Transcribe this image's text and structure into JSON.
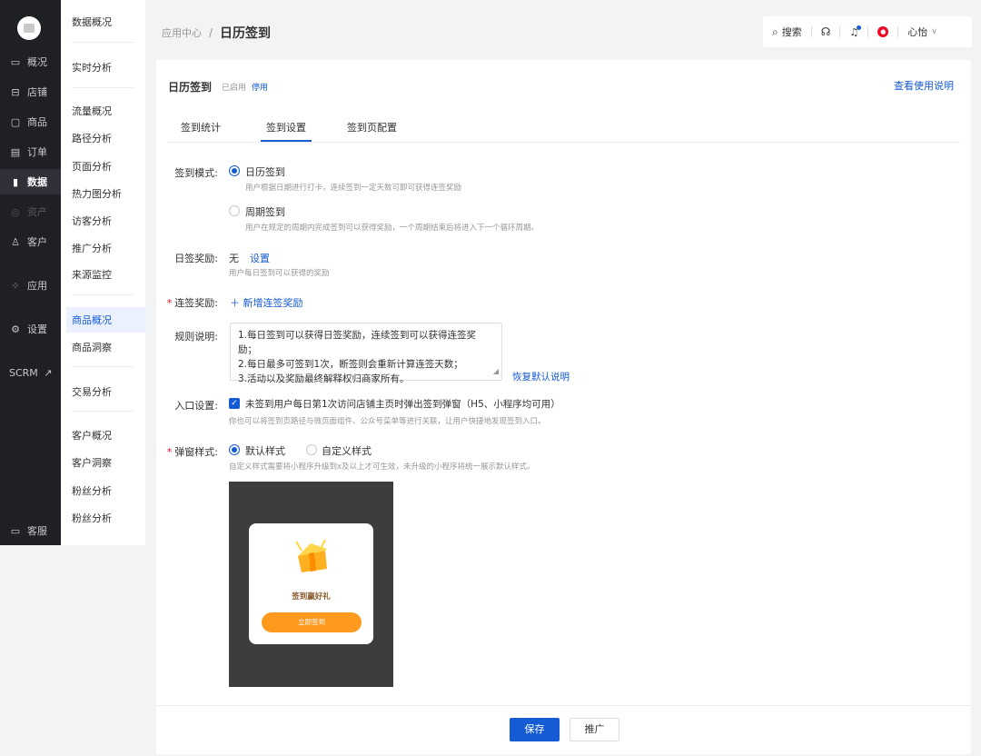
{
  "primary_nav": {
    "items": [
      {
        "icon": "chat-bubble-icon",
        "label": "概况"
      },
      {
        "icon": "store-icon",
        "label": "店铺"
      },
      {
        "icon": "bag-icon",
        "label": "商品"
      },
      {
        "icon": "document-icon",
        "label": "订单"
      },
      {
        "icon": "bar-chart-icon",
        "label": "数据"
      },
      {
        "icon": "coin-icon",
        "label": "资产"
      },
      {
        "icon": "user-icon",
        "label": "客户"
      },
      {
        "icon": "apps-icon",
        "label": "应用"
      },
      {
        "icon": "gear-icon",
        "label": "设置"
      },
      {
        "icon": "external-link-icon",
        "label": "SCRM"
      },
      {
        "icon": "chat-icon",
        "label": "客服"
      }
    ]
  },
  "secondary_nav": {
    "items": [
      "数据概况",
      "实时分析",
      "流量概况",
      "路径分析",
      "页面分析",
      "热力图分析",
      "访客分析",
      "推广分析",
      "来源监控",
      "商品概况",
      "商品洞察",
      "交易分析",
      "客户概况",
      "客户洞察",
      "粉丝分析",
      "粉丝分析"
    ]
  },
  "header": {
    "breadcrumb_parent": "应用中心",
    "breadcrumb_sep": "/",
    "breadcrumb_current": "日历签到",
    "search_label": "搜索",
    "user_name": "心怡"
  },
  "card": {
    "title": "日历签到",
    "status": "已启用",
    "disable_link": "停用",
    "help_link": "查看使用说明",
    "tabs": [
      "签到统计",
      "签到设置",
      "签到页配置"
    ]
  },
  "form": {
    "mode_label": "签到模式:",
    "mode_option1": "日历签到",
    "mode_option1_hint": "用户根据日期进行打卡，连续签到一定天数可即可获得连签奖励",
    "mode_option2": "周期签到",
    "mode_option2_hint": "用户在规定的周期内完成签到可以获得奖励，一个周期结束后将进入下一个循环周期。",
    "daily_label": "日签奖励:",
    "daily_value": "无",
    "daily_set": "设置",
    "daily_hint": "用户每日签到可以获得的奖励",
    "streak_label": "连签奖励:",
    "streak_add": "＋ 新增连签奖励",
    "rules_label": "规则说明:",
    "rules_text": "1.每日签到可以获得日签奖励，连续签到可以获得连签奖励；\n2.每日最多可签到1次，断签则会重新计算连签天数；\n3.活动以及奖励最终解释权归商家所有。",
    "rules_reset": "恢复默认说明",
    "entry_label": "入口设置:",
    "entry_check": "未签到用户每日第1次访问店铺主页时弹出签到弹窗（H5、小程序均可用）",
    "entry_hint": "你也可以将签到页路径与微页面组件、公众号菜单等进行关联，让用户快捷地发现签到入口。",
    "popup_label": "弹窗样式:",
    "popup_opt1": "默认样式",
    "popup_opt2": "自定义样式",
    "popup_hint": "自定义样式需要将小程序升级到x及以上才可生效，未升级的小程序将统一展示默认样式。",
    "preview_title": "签到赢好礼",
    "preview_button": "立即签到"
  },
  "footer": {
    "save": "保存",
    "promote": "推广"
  },
  "colors": {
    "brand": "#155bd4",
    "sidebar": "#1f2026",
    "preview_bg": "#3d3d3d",
    "preview_button": "#ff9a1f"
  }
}
